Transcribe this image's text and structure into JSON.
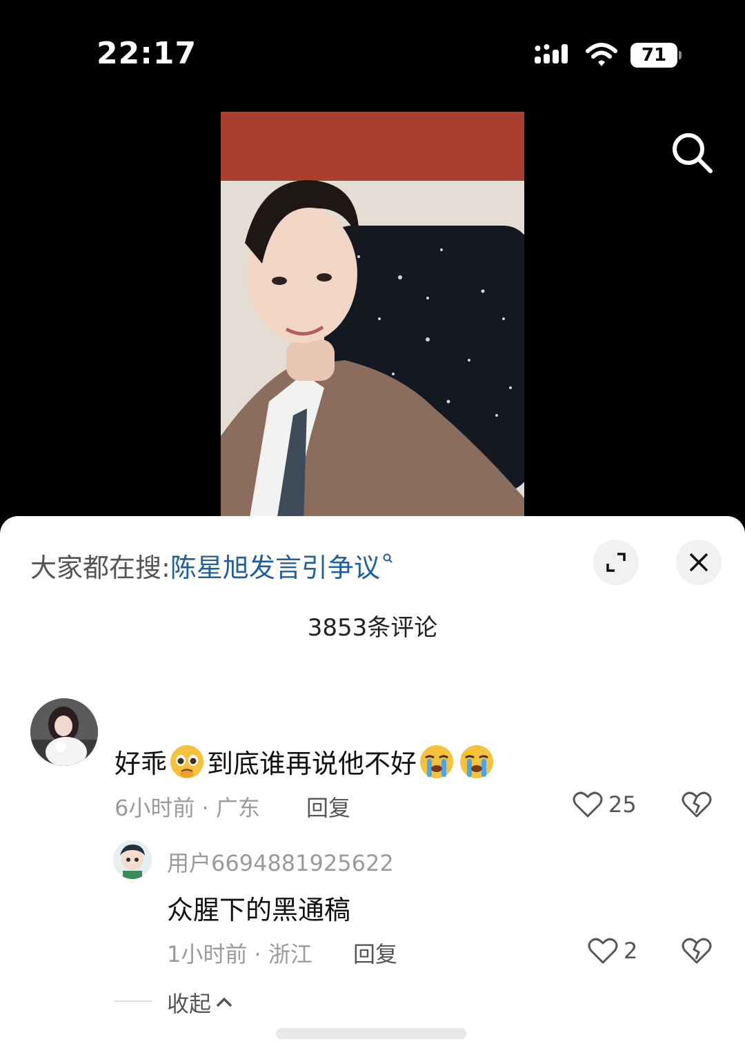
{
  "status_bar": {
    "time": "22:17",
    "battery": "71",
    "icons": [
      "signal-icon",
      "wifi-icon",
      "battery-icon"
    ]
  },
  "video": {
    "search_icon": "search-icon"
  },
  "sheet": {
    "search_prefix": "大家都在搜:",
    "search_term": "陈星旭发言引争议",
    "comment_count": "3853条评论",
    "icons": [
      "expand-icon",
      "close-icon"
    ]
  },
  "comments": [
    {
      "text_a": "好乖",
      "text_b": "到底谁再说他不好",
      "meta": "6小时前 · 广东",
      "reply_label": "回复",
      "likes": "25",
      "replies": [
        {
          "username": "用户6694881925622",
          "text": "众腥下的黑通稿",
          "meta": "1小时前 · 浙江",
          "reply_label": "回复",
          "likes": "2"
        }
      ]
    }
  ],
  "collapse_label": "收起",
  "colors": {
    "link": "#1f5fa0",
    "muted": "#9a9a9a",
    "sheet_bg": "#ffffff",
    "screen_bg": "#000000"
  }
}
